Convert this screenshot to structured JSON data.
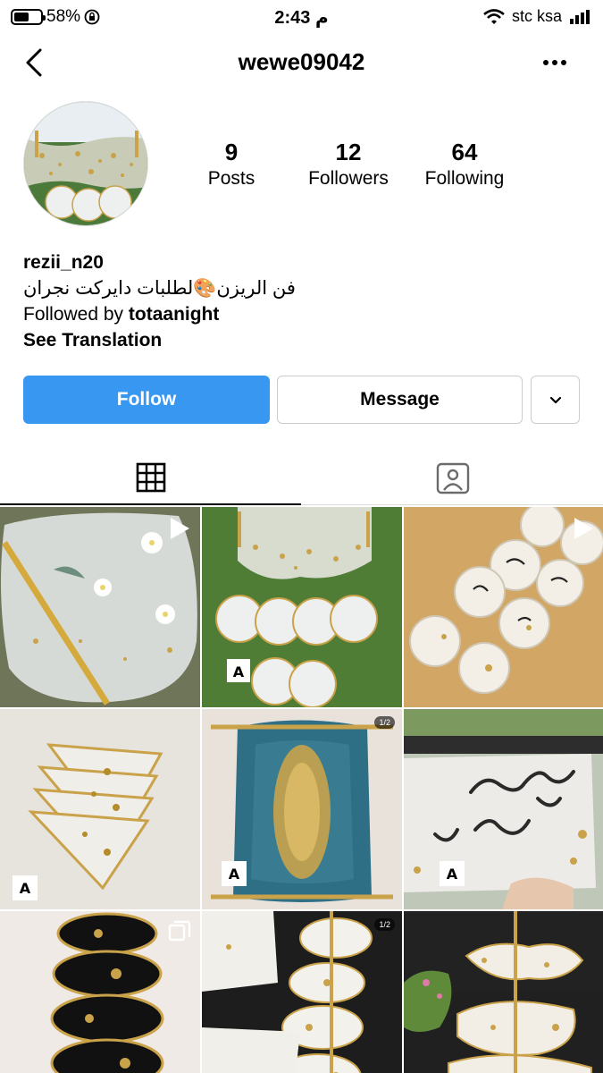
{
  "status_bar": {
    "battery": "58%",
    "battery_level": 0.58,
    "time": "2:43 م",
    "carrier": "stc ksa"
  },
  "header": {
    "username": "wewe09042"
  },
  "profile": {
    "posts_count": "9",
    "posts_label": "Posts",
    "followers_count": "12",
    "followers_label": "Followers",
    "following_count": "64",
    "following_label": "Following",
    "name": "rezii_n20",
    "bio_text": "فن الريزن🎨لطلبات دايركت نجران",
    "followed_by_prefix": "Followed by ",
    "followed_by_user": "totaanight",
    "see_translation": "See Translation"
  },
  "actions": {
    "follow_label": "Follow",
    "message_label": "Message"
  },
  "tabs": [
    {
      "name": "posts-grid",
      "icon": "grid-icon",
      "active": true
    },
    {
      "name": "tagged",
      "icon": "tagged-person-icon",
      "active": false
    }
  ],
  "grid_posts": [
    {
      "id": 1,
      "badge": "play-icon"
    },
    {
      "id": 2,
      "badge": ""
    },
    {
      "id": 3,
      "badge": "play-icon"
    },
    {
      "id": 4,
      "badge": ""
    },
    {
      "id": 5,
      "badge": "1/2"
    },
    {
      "id": 6,
      "badge": ""
    },
    {
      "id": 7,
      "badge": "multi-icon"
    },
    {
      "id": 8,
      "badge": "1/2"
    },
    {
      "id": 9,
      "badge": ""
    }
  ],
  "colors": {
    "follow_blue": "#3897f0",
    "resin_gold": "#c9a24a",
    "resin_teal": "#2e6f86"
  }
}
